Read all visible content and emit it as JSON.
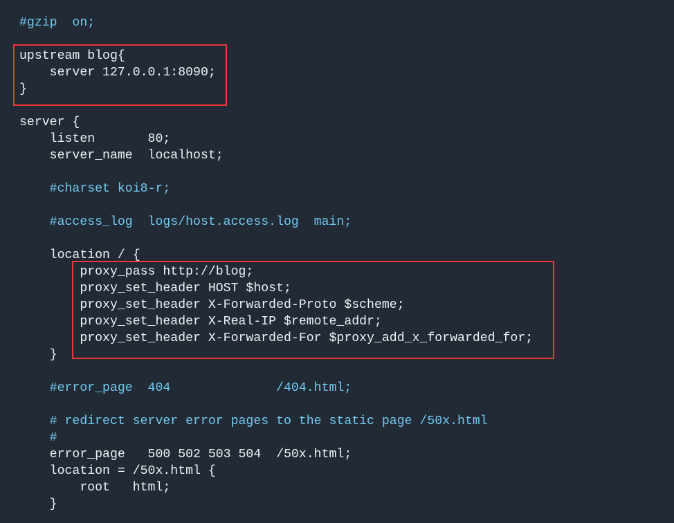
{
  "colors": {
    "background": "#212a35",
    "text": "#eef1f4",
    "comment": "#72c9ee",
    "highlight_box": "#f0373a"
  },
  "code_lines": [
    {
      "text": "#gzip  on;",
      "comment": true
    },
    {
      "text": "",
      "comment": false
    },
    {
      "text": "upstream blog{",
      "comment": false
    },
    {
      "text": "    server 127.0.0.1:8090;",
      "comment": false
    },
    {
      "text": "}",
      "comment": false
    },
    {
      "text": "",
      "comment": false
    },
    {
      "text": "server {",
      "comment": false
    },
    {
      "text": "    listen       80;",
      "comment": false
    },
    {
      "text": "    server_name  localhost;",
      "comment": false
    },
    {
      "text": "",
      "comment": false
    },
    {
      "text": "    #charset koi8-r;",
      "comment": true
    },
    {
      "text": "",
      "comment": false
    },
    {
      "text": "    #access_log  logs/host.access.log  main;",
      "comment": true
    },
    {
      "text": "",
      "comment": false
    },
    {
      "text": "    location / {",
      "comment": false
    },
    {
      "text": "        proxy_pass http://blog;",
      "comment": false
    },
    {
      "text": "        proxy_set_header HOST $host;",
      "comment": false
    },
    {
      "text": "        proxy_set_header X-Forwarded-Proto $scheme;",
      "comment": false
    },
    {
      "text": "        proxy_set_header X-Real-IP $remote_addr;",
      "comment": false
    },
    {
      "text": "        proxy_set_header X-Forwarded-For $proxy_add_x_forwarded_for;",
      "comment": false
    },
    {
      "text": "    }",
      "comment": false
    },
    {
      "text": "",
      "comment": false
    },
    {
      "text": "    #error_page  404              /404.html;",
      "comment": true
    },
    {
      "text": "",
      "comment": false
    },
    {
      "text": "    # redirect server error pages to the static page /50x.html",
      "comment": true
    },
    {
      "text": "    #",
      "comment": true
    },
    {
      "text": "    error_page   500 502 503 504  /50x.html;",
      "comment": false
    },
    {
      "text": "    location = /50x.html {",
      "comment": false
    },
    {
      "text": "        root   html;",
      "comment": false
    },
    {
      "text": "    }",
      "comment": false
    }
  ]
}
